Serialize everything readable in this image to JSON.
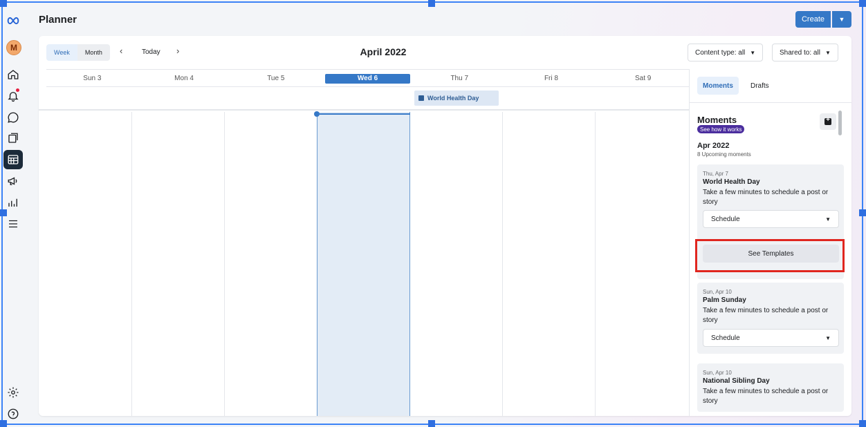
{
  "app": {
    "title": "Planner",
    "create_label": "Create",
    "user_initial": "M"
  },
  "rail": {
    "icons": [
      "meta-logo-icon",
      "home-icon",
      "notifications-icon",
      "messages-icon",
      "content-icon",
      "planner-icon",
      "ads-icon",
      "insights-icon",
      "menu-icon",
      "settings-icon",
      "help-icon"
    ]
  },
  "toolbar": {
    "views": [
      "Week",
      "Month"
    ],
    "active_view": "Week",
    "today_label": "Today",
    "period_title": "April 2022",
    "content_filter": "Content type: all",
    "shared_filter": "Shared to: all"
  },
  "calendar": {
    "days": [
      "Sun 3",
      "Mon 4",
      "Tue 5",
      "Wed 6",
      "Thu 7",
      "Fri 8",
      "Sat 9"
    ],
    "current_day": "Wed 6",
    "all_day_event": "World Health Day"
  },
  "panel": {
    "tabs": [
      "Moments",
      "Drafts"
    ],
    "active_tab": "Moments",
    "heading": "Moments",
    "badge": "See how it works",
    "month": "Apr 2022",
    "upcoming": "8 Upcoming moments",
    "moments": [
      {
        "date": "Thu, Apr 7",
        "name": "World Health Day",
        "desc": "Take a few minutes to schedule a post or story",
        "action": "Schedule",
        "templates": "See Templates"
      },
      {
        "date": "Sun, Apr 10",
        "name": "Palm Sunday",
        "desc": "Take a few minutes to schedule a post or story",
        "action": "Schedule"
      },
      {
        "date": "Sun, Apr 10",
        "name": "National Sibling Day",
        "desc": "Take a few minutes to schedule a post or story"
      }
    ]
  },
  "colors": {
    "accent": "#3578c7",
    "highlight": "#e0261f",
    "badge": "#4b2e9e"
  }
}
